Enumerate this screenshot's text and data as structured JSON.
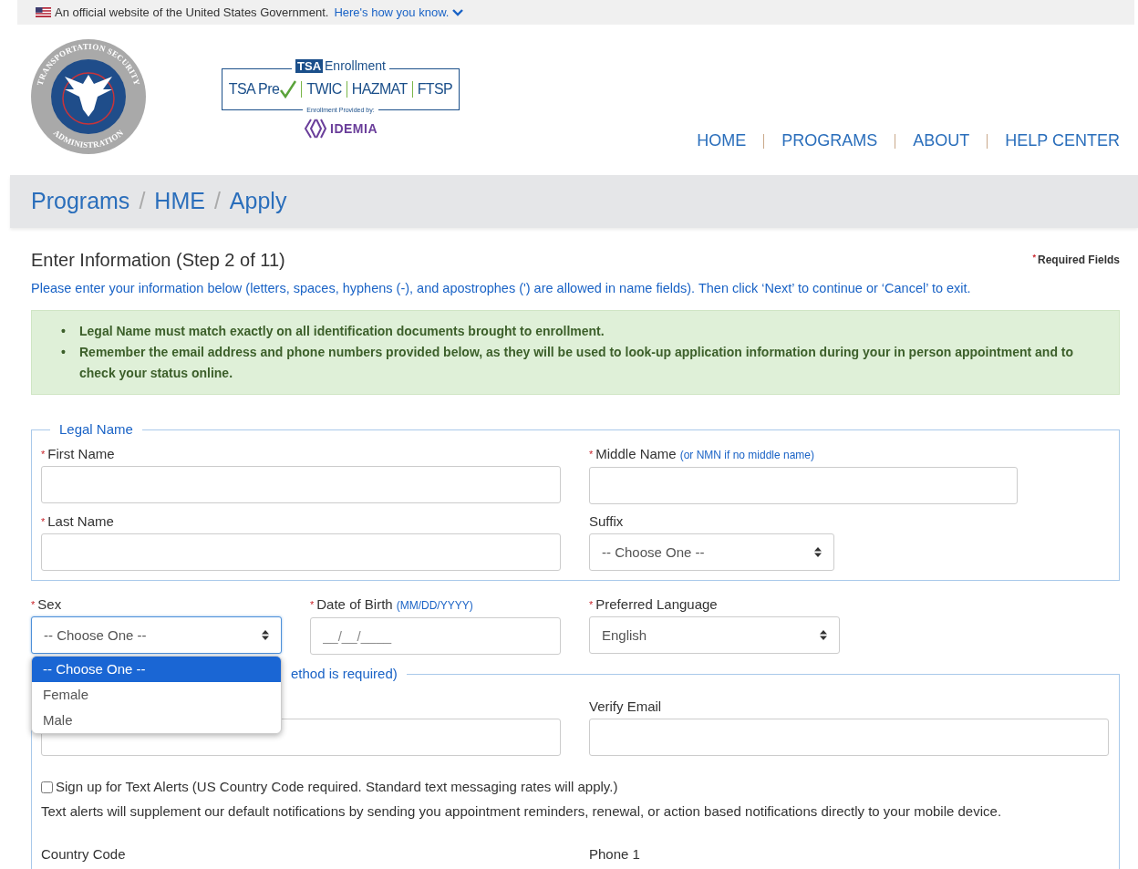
{
  "gov_banner": {
    "text": "An official website of the United States Government.",
    "link": "Here's how you know."
  },
  "header": {
    "seal": {
      "top": "TRANSPORTATION SECURITY",
      "bottom": "ADMINISTRATION"
    },
    "logo": {
      "badge": "TSA",
      "title": "Enrollment",
      "programs": [
        "TSA Pre",
        "TWIC",
        "HAZMAT",
        "FTSP"
      ],
      "provided_by": "Enrollment Provided by:",
      "provider": "IDEMIA"
    },
    "nav": [
      "HOME",
      "PROGRAMS",
      "ABOUT",
      "HELP CENTER"
    ]
  },
  "breadcrumb": [
    "Programs",
    "HME",
    "Apply"
  ],
  "breadcrumb_separator": "/",
  "bullet": "•",
  "required_mark": "*",
  "page_title": "Enter Information (Step 2 of 11)",
  "required_note": "Required Fields",
  "instructions": "Please enter your information below (letters, spaces, hyphens (-), and apostrophes (') are allowed in name fields). Then click ‘Next’ to continue or ‘Cancel’ to exit.",
  "notices": [
    "Legal Name must match exactly on all identification documents brought to enrollment.",
    "Remember the email address and phone numbers provided below, as they will be used to look-up application information during your in person appointment and to check your status online."
  ],
  "legal_name": {
    "legend": "Legal Name",
    "fields": [
      {
        "kind": "text",
        "label": "First Name",
        "required": true
      },
      {
        "kind": "text",
        "label": "Middle Name",
        "required": true,
        "hint": "(or NMN if no middle name)"
      },
      {
        "kind": "text",
        "label": "Last Name",
        "required": true
      },
      {
        "kind": "select",
        "label": "Suffix",
        "required": false,
        "value": "-- Choose One --"
      }
    ]
  },
  "personal_fields": [
    {
      "kind": "select",
      "label": "Sex",
      "required": true,
      "value": "-- Choose One --",
      "focused": true
    },
    {
      "kind": "text",
      "label": "Date of Birth",
      "required": true,
      "hint": "(MM/DD/YYYY)",
      "placeholder": "__/__/____",
      "focused": false
    },
    {
      "kind": "select",
      "label": "Preferred Language",
      "required": true,
      "value": "English",
      "focused": false
    }
  ],
  "sex_dropdown": {
    "options": [
      {
        "label": "-- Choose One --",
        "selected": true
      },
      {
        "label": "Female",
        "selected": false
      },
      {
        "label": "Male",
        "selected": false
      }
    ]
  },
  "contact": {
    "legend": "ethod is required)",
    "fields": [
      {
        "kind": "text"
      },
      {
        "kind": "text",
        "label": "Verify Email",
        "required": false
      }
    ],
    "text_alerts": {
      "checked": false,
      "label": "Sign up for Text Alerts (US Country Code required. Standard text messaging rates will apply.)",
      "description": "Text alerts will supplement our default notifications by sending you appointment reminders, renewal, or action based notifications directly to your mobile device."
    },
    "phone_labels": [
      "Country Code",
      "Phone 1"
    ]
  }
}
